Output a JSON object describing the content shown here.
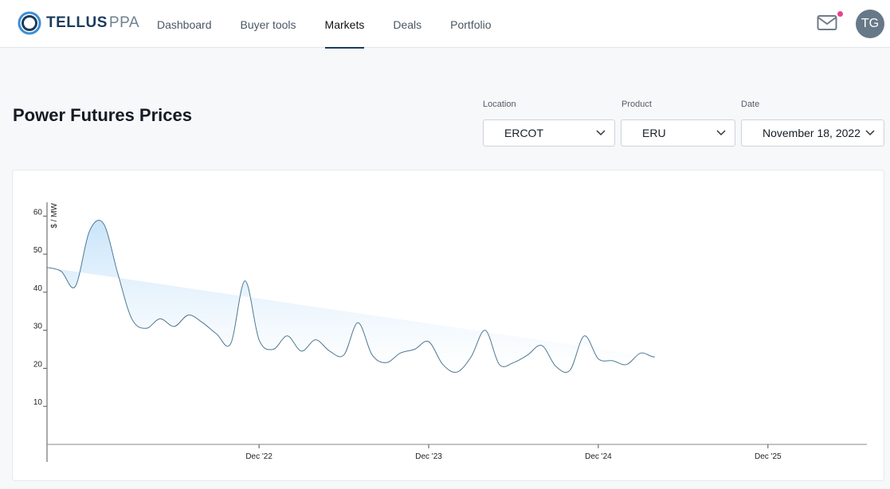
{
  "brand": {
    "strong": "TELLUS",
    "light": "PPA"
  },
  "nav": {
    "items": [
      {
        "label": "Dashboard"
      },
      {
        "label": "Buyer tools"
      },
      {
        "label": "Markets",
        "active": true
      },
      {
        "label": "Deals"
      },
      {
        "label": "Portfolio"
      }
    ]
  },
  "user": {
    "initials": "TG",
    "notification_color": "#e8438c"
  },
  "page": {
    "title": "Power Futures Prices"
  },
  "filters": {
    "location": {
      "label": "Location",
      "value": "ERCOT"
    },
    "product": {
      "label": "Product",
      "value": "ERU"
    },
    "date": {
      "label": "Date",
      "value": "November 18, 2022"
    }
  },
  "colors": {
    "accent": "#1b3b5c",
    "line": "#4f7893",
    "fill_top": "#c9e4fa",
    "fill_bottom": "#ffffff"
  },
  "chart_data": {
    "type": "area",
    "ylabel": "$ / MW",
    "ylim": [
      0,
      63
    ],
    "yticks": [
      10,
      20,
      30,
      40,
      50,
      60
    ],
    "x_tick_labels": [
      "Dec '22",
      "Dec '23",
      "Dec '24",
      "Dec '25"
    ],
    "x_tick_months": [
      13,
      25,
      37,
      49
    ],
    "xlim": [
      -2,
      56
    ],
    "grid": false,
    "legend": "none",
    "x_months": [
      -2,
      -1,
      0,
      1,
      2,
      3,
      4,
      5,
      6,
      7,
      8,
      9,
      10,
      11,
      12,
      13,
      14,
      15,
      16,
      17,
      18,
      19,
      20,
      21,
      22,
      23,
      24,
      25,
      26,
      27,
      28,
      29,
      30,
      31,
      32,
      33,
      34,
      35,
      36,
      37,
      38,
      39,
      40,
      41,
      42,
      43,
      44,
      45,
      46,
      47,
      48,
      49,
      50,
      51,
      52,
      53,
      54,
      55,
      56
    ],
    "values": [
      46.5,
      45.5,
      41.5,
      56,
      58,
      45,
      33,
      30.5,
      33,
      31,
      34,
      32,
      29,
      26.5,
      43,
      27.5,
      25,
      28.5,
      24.5,
      27.5,
      24.5,
      23.5,
      32,
      23.5,
      21.5,
      24,
      25,
      27,
      21,
      19,
      23,
      30,
      21,
      21.5,
      23.5,
      26,
      20.5,
      19.5,
      28.5,
      22.5,
      22,
      21,
      24,
      23,
      25
    ]
  }
}
